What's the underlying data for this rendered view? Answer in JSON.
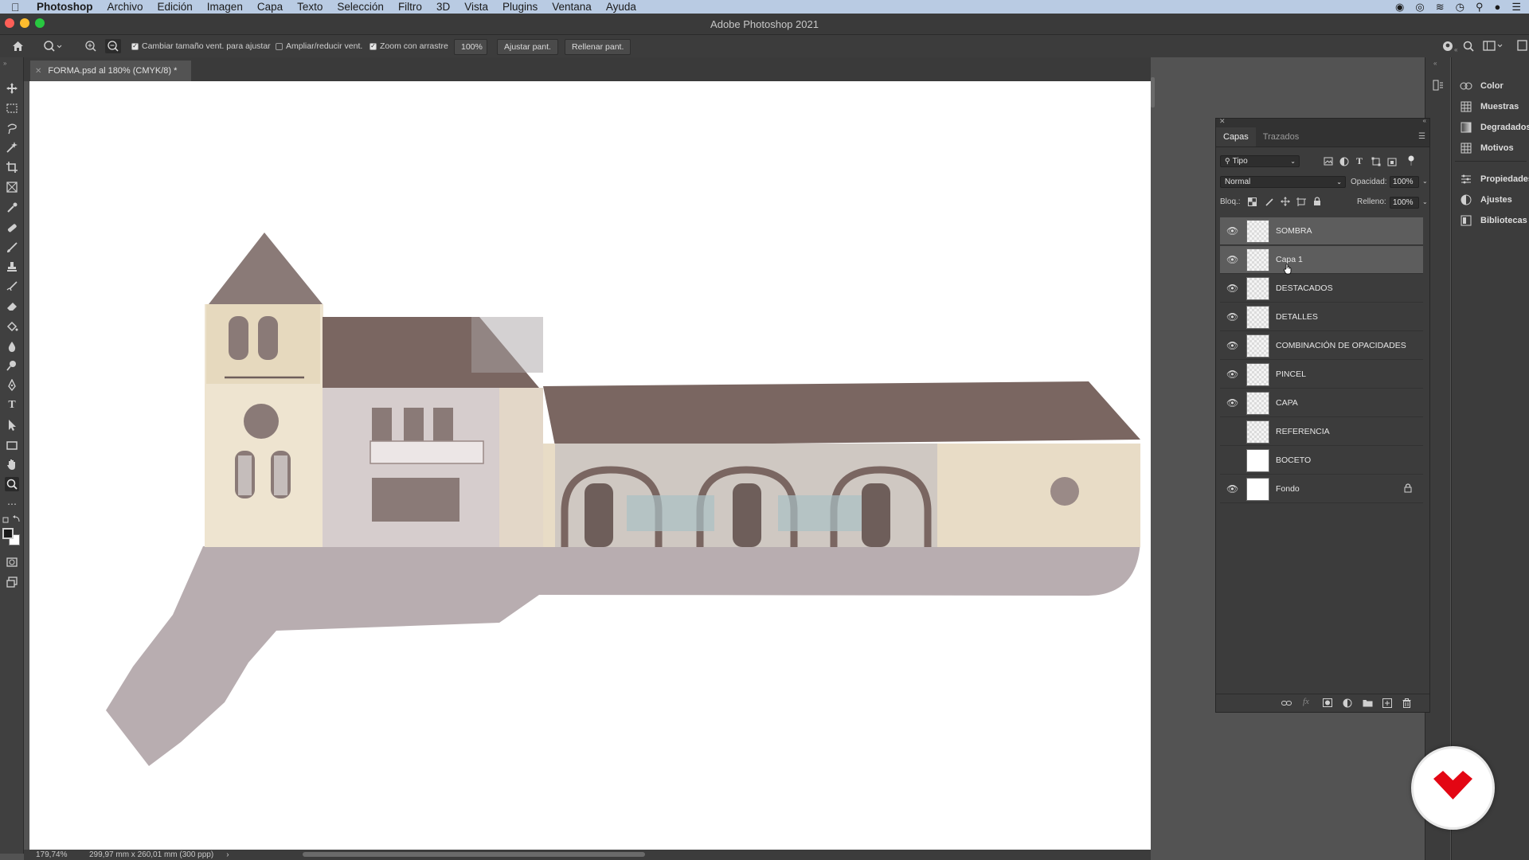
{
  "menubar": {
    "app_name": "Photoshop",
    "items": [
      "Archivo",
      "Edición",
      "Imagen",
      "Capa",
      "Texto",
      "Selección",
      "Filtro",
      "3D",
      "Vista",
      "Plugins",
      "Ventana",
      "Ayuda"
    ]
  },
  "window": {
    "title": "Adobe Photoshop 2021"
  },
  "options_bar": {
    "resize_windows_label": "Cambiar tamaño vent. para ajustar",
    "resize_windows_checked": true,
    "zoom_all_windows_label": "Ampliar/reducir vent.",
    "zoom_all_windows_checked": false,
    "scrubby_zoom_label": "Zoom con arrastre",
    "scrubby_zoom_checked": true,
    "zoom_value": "100%",
    "fit_screen_label": "Ajustar pant.",
    "fill_screen_label": "Rellenar pant."
  },
  "document": {
    "tab_title": "FORMA.psd al 180% (CMYK/8) *"
  },
  "status": {
    "zoom": "179,74%",
    "doc_info": "299,97 mm x 260,01 mm (300 ppp)"
  },
  "layers_panel": {
    "tabs": [
      "Capas",
      "Trazados"
    ],
    "filter_kind": "Tipo",
    "blend_mode": "Normal",
    "opacity_label": "Opacidad:",
    "opacity_value": "100%",
    "lock_label": "Bloq.:",
    "fill_label": "Relleno:",
    "fill_value": "100%",
    "layers": [
      {
        "name": "SOMBRA",
        "visible": true,
        "selected": true
      },
      {
        "name": "Capa 1",
        "visible": true,
        "selected": true
      },
      {
        "name": "DESTACADOS",
        "visible": true,
        "selected": false
      },
      {
        "name": "DETALLES",
        "visible": true,
        "selected": false
      },
      {
        "name": "COMBINACIÓN DE OPACIDADES",
        "visible": true,
        "selected": false
      },
      {
        "name": "PINCEL",
        "visible": true,
        "selected": false
      },
      {
        "name": "CAPA",
        "visible": true,
        "selected": false
      },
      {
        "name": "REFERENCIA",
        "visible": false,
        "selected": false
      },
      {
        "name": "BOCETO",
        "visible": false,
        "selected": false
      },
      {
        "name": "Fondo",
        "visible": true,
        "selected": false,
        "locked": true
      }
    ]
  },
  "dock": {
    "items": [
      "Color",
      "Muestras",
      "Degradados",
      "Motivos",
      "Propiedades",
      "Ajustes",
      "Bibliotecas"
    ]
  },
  "colors": {
    "ui_dark": "#3c3c3c",
    "ui_mid": "#535353",
    "canvas": "#ffffff",
    "brand_red": "#e30613",
    "roof": "#7a6661",
    "wall": "#e8dcc6",
    "shadow": "#b8adb0"
  }
}
